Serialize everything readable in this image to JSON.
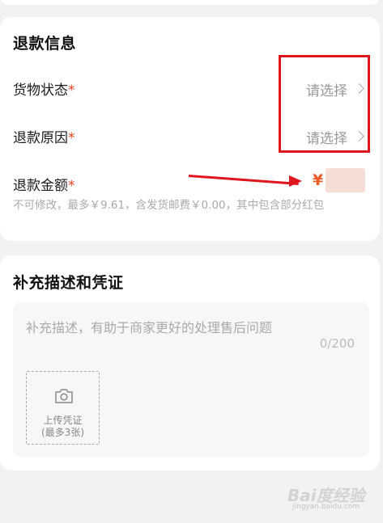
{
  "refund_section": {
    "title": "退款信息",
    "goods_status": {
      "label": "货物状态",
      "required": "*",
      "value": "请选择"
    },
    "refund_reason": {
      "label": "退款原因",
      "required": "*",
      "value": "请选择"
    },
    "refund_amount": {
      "label": "退款金额",
      "required": "*",
      "currency": "¥"
    },
    "hint": "不可修改，最多￥9.61，含发货邮费￥0.00，其中包含部分红包"
  },
  "supplement_section": {
    "title": "补充描述和凭证",
    "placeholder": "补充描述，有助于商家更好的处理售后问题",
    "counter": "0/200",
    "upload": {
      "line1": "上传凭证",
      "line2": "(最多3张)"
    }
  },
  "watermark": {
    "text": "Bai度经验",
    "sub": "jingyan.baidu.com"
  },
  "colors": {
    "accent": "#ee5a24",
    "required": "#e8441f",
    "annotation": "#e0161f"
  }
}
